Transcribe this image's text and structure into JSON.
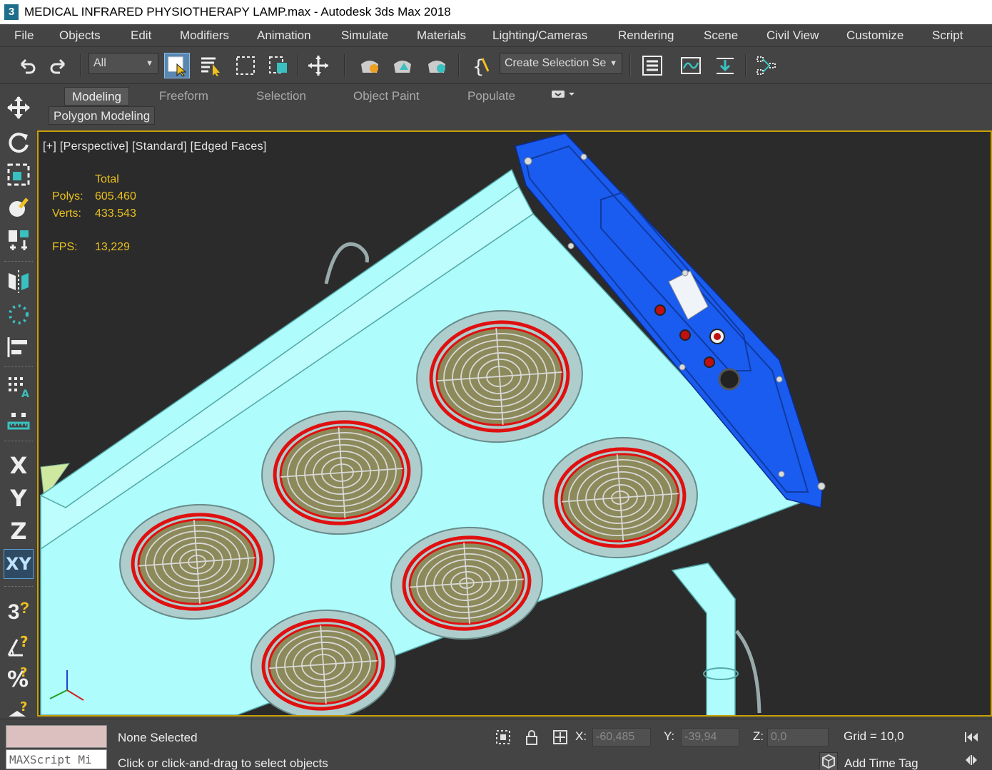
{
  "window": {
    "icon_text": "3",
    "title": "MEDICAL INFRARED PHYSIOTHERAPY LAMP.max - Autodesk 3ds Max 2018"
  },
  "menu": [
    "File",
    "Objects",
    "Edit",
    "Modifiers",
    "Animation",
    "Simulate",
    "Materials",
    "Lighting/Cameras",
    "Rendering",
    "Scene",
    "Civil View",
    "Customize",
    "Script"
  ],
  "toolbar": {
    "filter_value": "All",
    "selection_set_value": "Create Selection Se"
  },
  "ribbon": {
    "tabs": [
      "Modeling",
      "Freeform",
      "Selection",
      "Object Paint",
      "Populate"
    ],
    "active_tab": "Modeling",
    "panel_label": "Polygon Modeling"
  },
  "left_tools": {
    "axis_x": "X",
    "axis_y": "Y",
    "axis_z": "Z",
    "axis_xy": "XY",
    "snap_3": "3"
  },
  "viewport": {
    "label": "[+] [Perspective] [Standard] [Edged Faces]",
    "stats": {
      "header": "Total",
      "polys_label": "Polys:",
      "polys_value": "605.460",
      "verts_label": "Verts:",
      "verts_value": "433.543",
      "fps_label": "FPS:",
      "fps_value": "13,229"
    },
    "colors": {
      "background": "#2b2b2b",
      "panel": "#aefcfc",
      "control_box": "#1a5cf0",
      "ring": "#e01010",
      "grill": "#8c8a5a",
      "border_active": "#c8a000"
    }
  },
  "status": {
    "maxscript_placeholder": "MAXScript Mi",
    "selection": "None Selected",
    "prompt": "Click or click-and-drag to select objects",
    "x_label": "X:",
    "x_value": "-60,485",
    "y_label": "Y:",
    "y_value": "-39,94",
    "z_label": "Z:",
    "z_value": "0,0",
    "grid": "Grid = 10,0",
    "time_tag": "Add Time Tag"
  }
}
